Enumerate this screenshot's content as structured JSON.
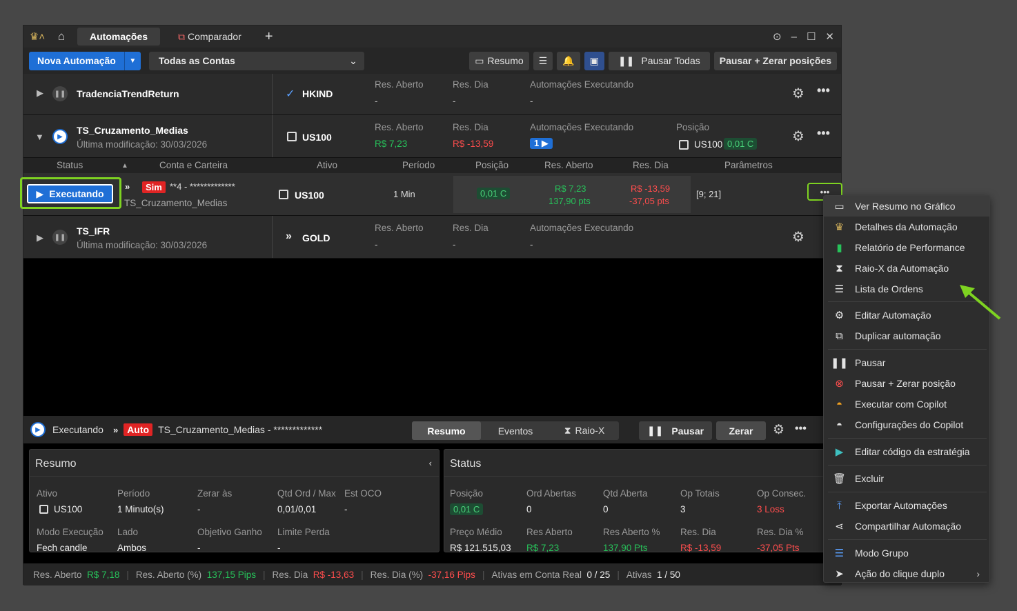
{
  "titlebar": {
    "tabs": [
      "Automações",
      "Comparador"
    ],
    "add": "+"
  },
  "toolbar": {
    "new_automation": "Nova Automação",
    "account_select": "Todas as Contas",
    "resumo": "Resumo",
    "pause_all": "Pausar Todas",
    "pause_zero": "Pausar + Zerar posições"
  },
  "groups": [
    {
      "name": "TradenciaTrendReturn",
      "asset": "HKIND",
      "res_aberto_label": "Res. Aberto",
      "res_aberto": "-",
      "res_dia_label": "Res. Dia",
      "res_dia": "-",
      "exec_label": "Automações Executando",
      "exec": "-"
    },
    {
      "name": "TS_Cruzamento_Medias",
      "modified": "Última modificação: 30/03/2026",
      "asset": "US100",
      "res_aberto_label": "Res. Aberto",
      "res_aberto": "R$ 7,23",
      "res_dia_label": "Res. Dia",
      "res_dia": "R$ -13,59",
      "exec_label": "Automações Executando",
      "exec": "1",
      "pos_label": "Posição",
      "pos_asset": "US100",
      "pos_val": "0,01 C"
    },
    {
      "name": "TS_IFR",
      "modified": "Última modificação: 30/03/2026",
      "asset": "GOLD",
      "res_aberto_label": "Res. Aberto",
      "res_aberto": "-",
      "res_dia_label": "Res. Dia",
      "res_dia": "-",
      "exec_label": "Automações Executando",
      "exec": "-"
    }
  ],
  "table_headers": [
    "Status",
    "Conta e Carteira",
    "Ativo",
    "Período",
    "Posição",
    "Res. Aberto",
    "Res. Dia",
    "Parâmetros"
  ],
  "auto_row": {
    "status": "Executando",
    "sim": "Sim",
    "account": "**4 - *************",
    "wallet": "TS_Cruzamento_Medias",
    "asset": "US100",
    "period": "1 Min",
    "position": "0,01 C",
    "res_aberto": "R$ 7,23",
    "res_aberto_pts": "137,90 pts",
    "res_dia": "R$ -13,59",
    "res_dia_pts": "-37,05 pts",
    "params": "[9; 21]"
  },
  "detail": {
    "status": "Executando",
    "auto": "Auto",
    "title": "TS_Cruzamento_Medias - *************",
    "tabs": [
      "Resumo",
      "Eventos",
      "Raio-X"
    ],
    "pause": "Pausar",
    "zero": "Zerar"
  },
  "resumo": {
    "title": "Resumo",
    "fields": [
      {
        "l": "Ativo",
        "v": "US100"
      },
      {
        "l": "Período",
        "v": "1 Minuto(s)"
      },
      {
        "l": "Zerar às",
        "v": "-"
      },
      {
        "l": "Qtd Ord / Max",
        "v": "0,01/0,01"
      },
      {
        "l": "Est OCO",
        "v": "-"
      },
      {
        "l": "Modo Execução",
        "v": "Fech candle"
      },
      {
        "l": "Lado",
        "v": "Ambos"
      },
      {
        "l": "Objetivo Ganho",
        "v": "-"
      },
      {
        "l": "Limite Perda",
        "v": "-"
      }
    ]
  },
  "status_panel": {
    "title": "Status",
    "fields": [
      {
        "l": "Posição",
        "v": "0,01 C"
      },
      {
        "l": "Ord Abertas",
        "v": "0"
      },
      {
        "l": "Qtd Aberta",
        "v": "0"
      },
      {
        "l": "Op Totais",
        "v": "3"
      },
      {
        "l": "Op Consec.",
        "v": "3 Loss"
      },
      {
        "l": "Preço Médio",
        "v": "R$ 121.515,03"
      },
      {
        "l": "Res Aberto",
        "v": "R$ 7,23"
      },
      {
        "l": "Res Aberto %",
        "v": "137,90 Pts"
      },
      {
        "l": "Res. Dia",
        "v": "R$ -13,59"
      },
      {
        "l": "Res. Dia %",
        "v": "-37,05 Pts"
      }
    ]
  },
  "statusbar": {
    "res_aberto_l": "Res. Aberto",
    "res_aberto": "R$ 7,18",
    "res_aberto_pct_l": "Res. Aberto (%)",
    "res_aberto_pct": "137,15 Pips",
    "res_dia_l": "Res. Dia",
    "res_dia": "R$ -13,63",
    "res_dia_pct_l": "Res. Dia (%)",
    "res_dia_pct": "-37,16 Pips",
    "ativas_real_l": "Ativas em Conta Real",
    "ativas_real": "0 / 25",
    "ativas_l": "Ativas",
    "ativas": "1 / 50"
  },
  "menu": [
    "Ver Resumo no Gráfico",
    "Detalhes da Automação",
    "Relatório de Performance",
    "Raio-X da Automação",
    "Lista de Ordens",
    "Editar Automação",
    "Duplicar automação",
    "Pausar",
    "Pausar + Zerar posição",
    "Executar com Copilot",
    "Configurações do Copilot",
    "Editar código da estratégia",
    "Excluir",
    "Exportar Automações",
    "Compartilhar Automação",
    "Modo Grupo",
    "Ação do clique duplo"
  ]
}
